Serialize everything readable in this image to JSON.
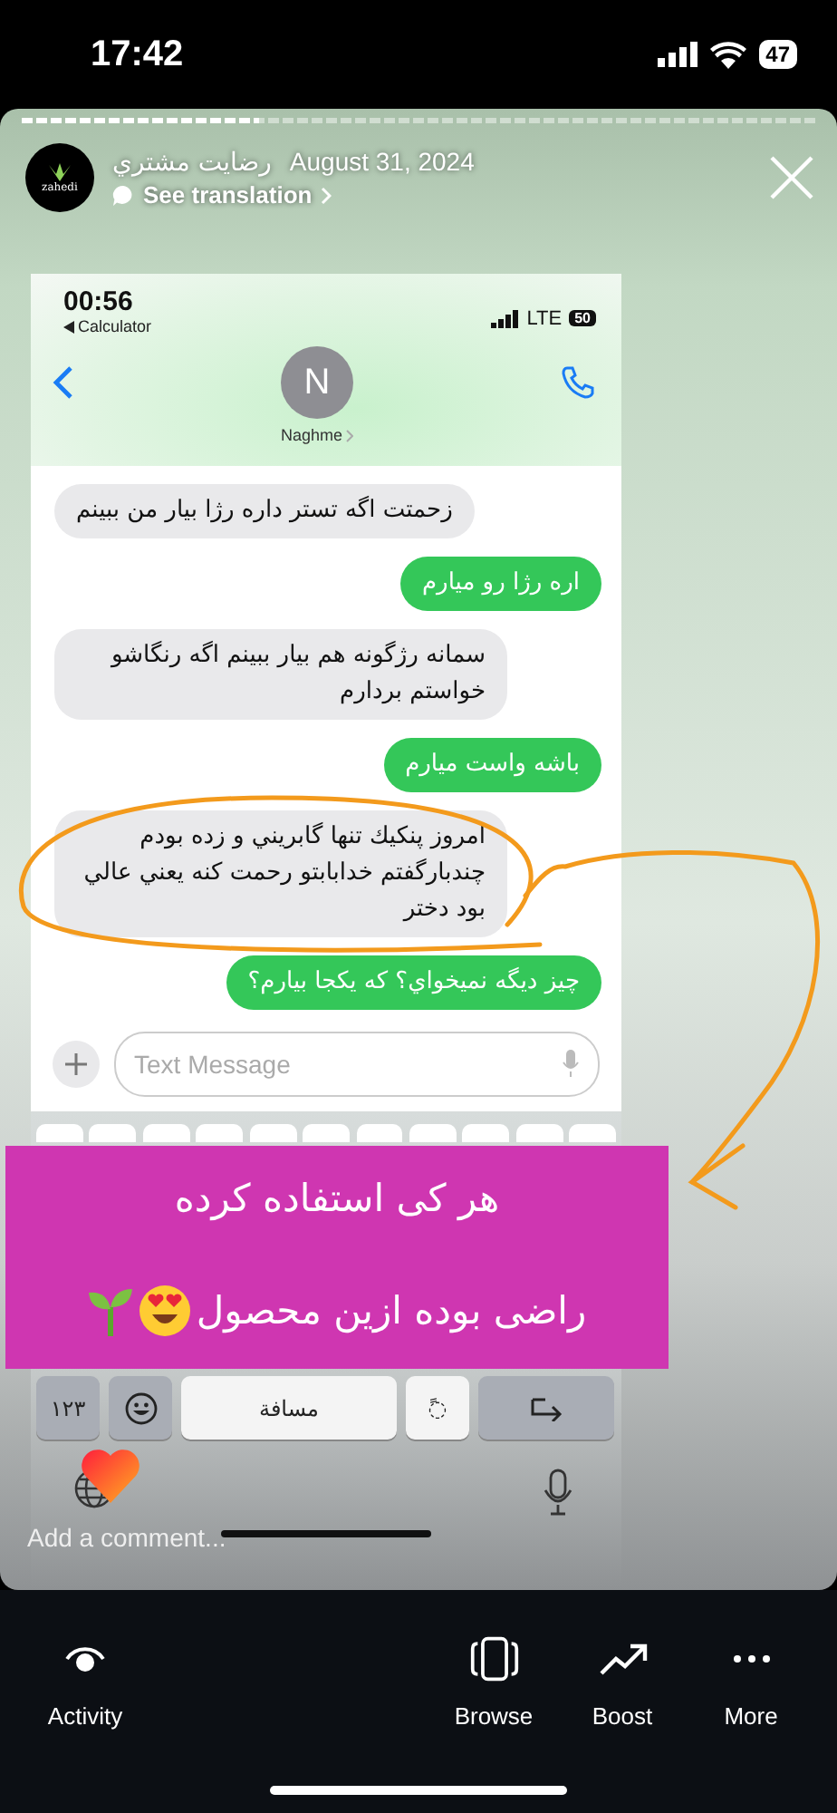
{
  "status_bar": {
    "time": "17:42",
    "battery": "47"
  },
  "story": {
    "progress": {
      "level": 0.3
    },
    "account": {
      "logo_text": "zahedi",
      "name": "رضايت مشتري"
    },
    "date": "August 31, 2024",
    "translation_link": "See translation",
    "screenshot": {
      "status_bar": {
        "time": "00:56",
        "back_app": "Calculator",
        "network": "LTE",
        "battery": "50"
      },
      "contact": {
        "initial": "N",
        "name": "Naghme"
      },
      "messages": [
        {
          "kind": "incoming",
          "text": "زحمتت اگه تستر داره رژا بيار من ببينم"
        },
        {
          "kind": "outgoing",
          "text": "اره رژا رو ميارم"
        },
        {
          "kind": "incoming",
          "text": "سمانه رژگونه هم بيار ببينم اگه رنگاشو خواستم بردارم"
        },
        {
          "kind": "outgoing",
          "text": "باشه واست ميارم"
        },
        {
          "kind": "incoming",
          "text": "امروز پنكيك تنها گابريني و زده بودم چندبارگفتم خدابابتو رحمت كنه يعني عالي بود دختر"
        },
        {
          "kind": "outgoing",
          "text": "چيز ديگه نميخواي؟ كه يكجا بيارم؟"
        }
      ],
      "input": {
        "placeholder": "Text Message"
      },
      "keyboard": {
        "numbers_key": "۱۲۳",
        "space_key": "مسافة",
        "accent_key": "◌ً"
      }
    },
    "sticker": {
      "lines": [
        "هر کی استفاده کرده",
        "راضی بوده ازین محصول"
      ]
    },
    "comment": {
      "placeholder": "Add a comment..."
    }
  },
  "activity_action": {
    "kind": "activity",
    "label": "Activity"
  },
  "browse_action": {
    "kind": "browse",
    "label": "Browse"
  },
  "boost_action": {
    "kind": "boost",
    "label": "Boost"
  },
  "more_action": {
    "kind": "more",
    "label": "More"
  }
}
